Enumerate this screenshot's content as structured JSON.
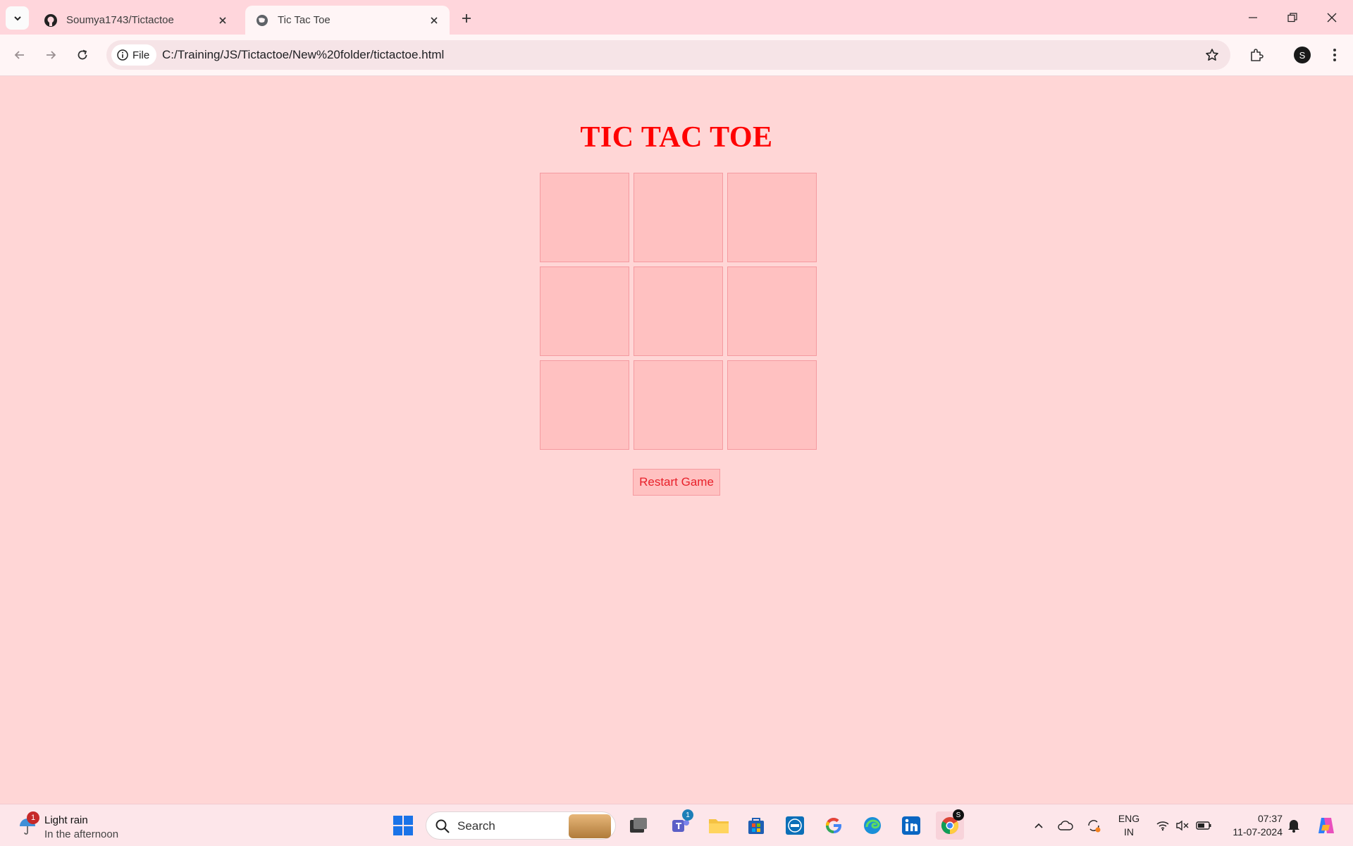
{
  "browser": {
    "tabs": [
      {
        "title": "Soumya1743/Tictactoe",
        "icon": "github-icon",
        "active": false
      },
      {
        "title": "Tic Tac Toe",
        "icon": "globe-icon",
        "active": true
      }
    ],
    "address_bar": {
      "chip_label": "File",
      "url": "C:/Training/JS/Tictactoe/New%20folder/tictactoe.html"
    },
    "profile_initial": "S"
  },
  "page": {
    "title": "TIC TAC TOE",
    "board": [
      "",
      "",
      "",
      "",
      "",
      "",
      "",
      "",
      ""
    ],
    "restart_label": "Restart Game",
    "colors": {
      "background": "#ffd6d6",
      "cell": "#ffc1c1",
      "accent": "#ff0000"
    }
  },
  "taskbar": {
    "weather": {
      "title": "Light rain",
      "subtitle": "In the afternoon",
      "badge": "1"
    },
    "search_placeholder": "Search",
    "teams_badge": "1",
    "chrome_badge": "S",
    "language": {
      "line1": "ENG",
      "line2": "IN"
    },
    "clock": {
      "time": "07:37",
      "date": "11-07-2024"
    }
  }
}
